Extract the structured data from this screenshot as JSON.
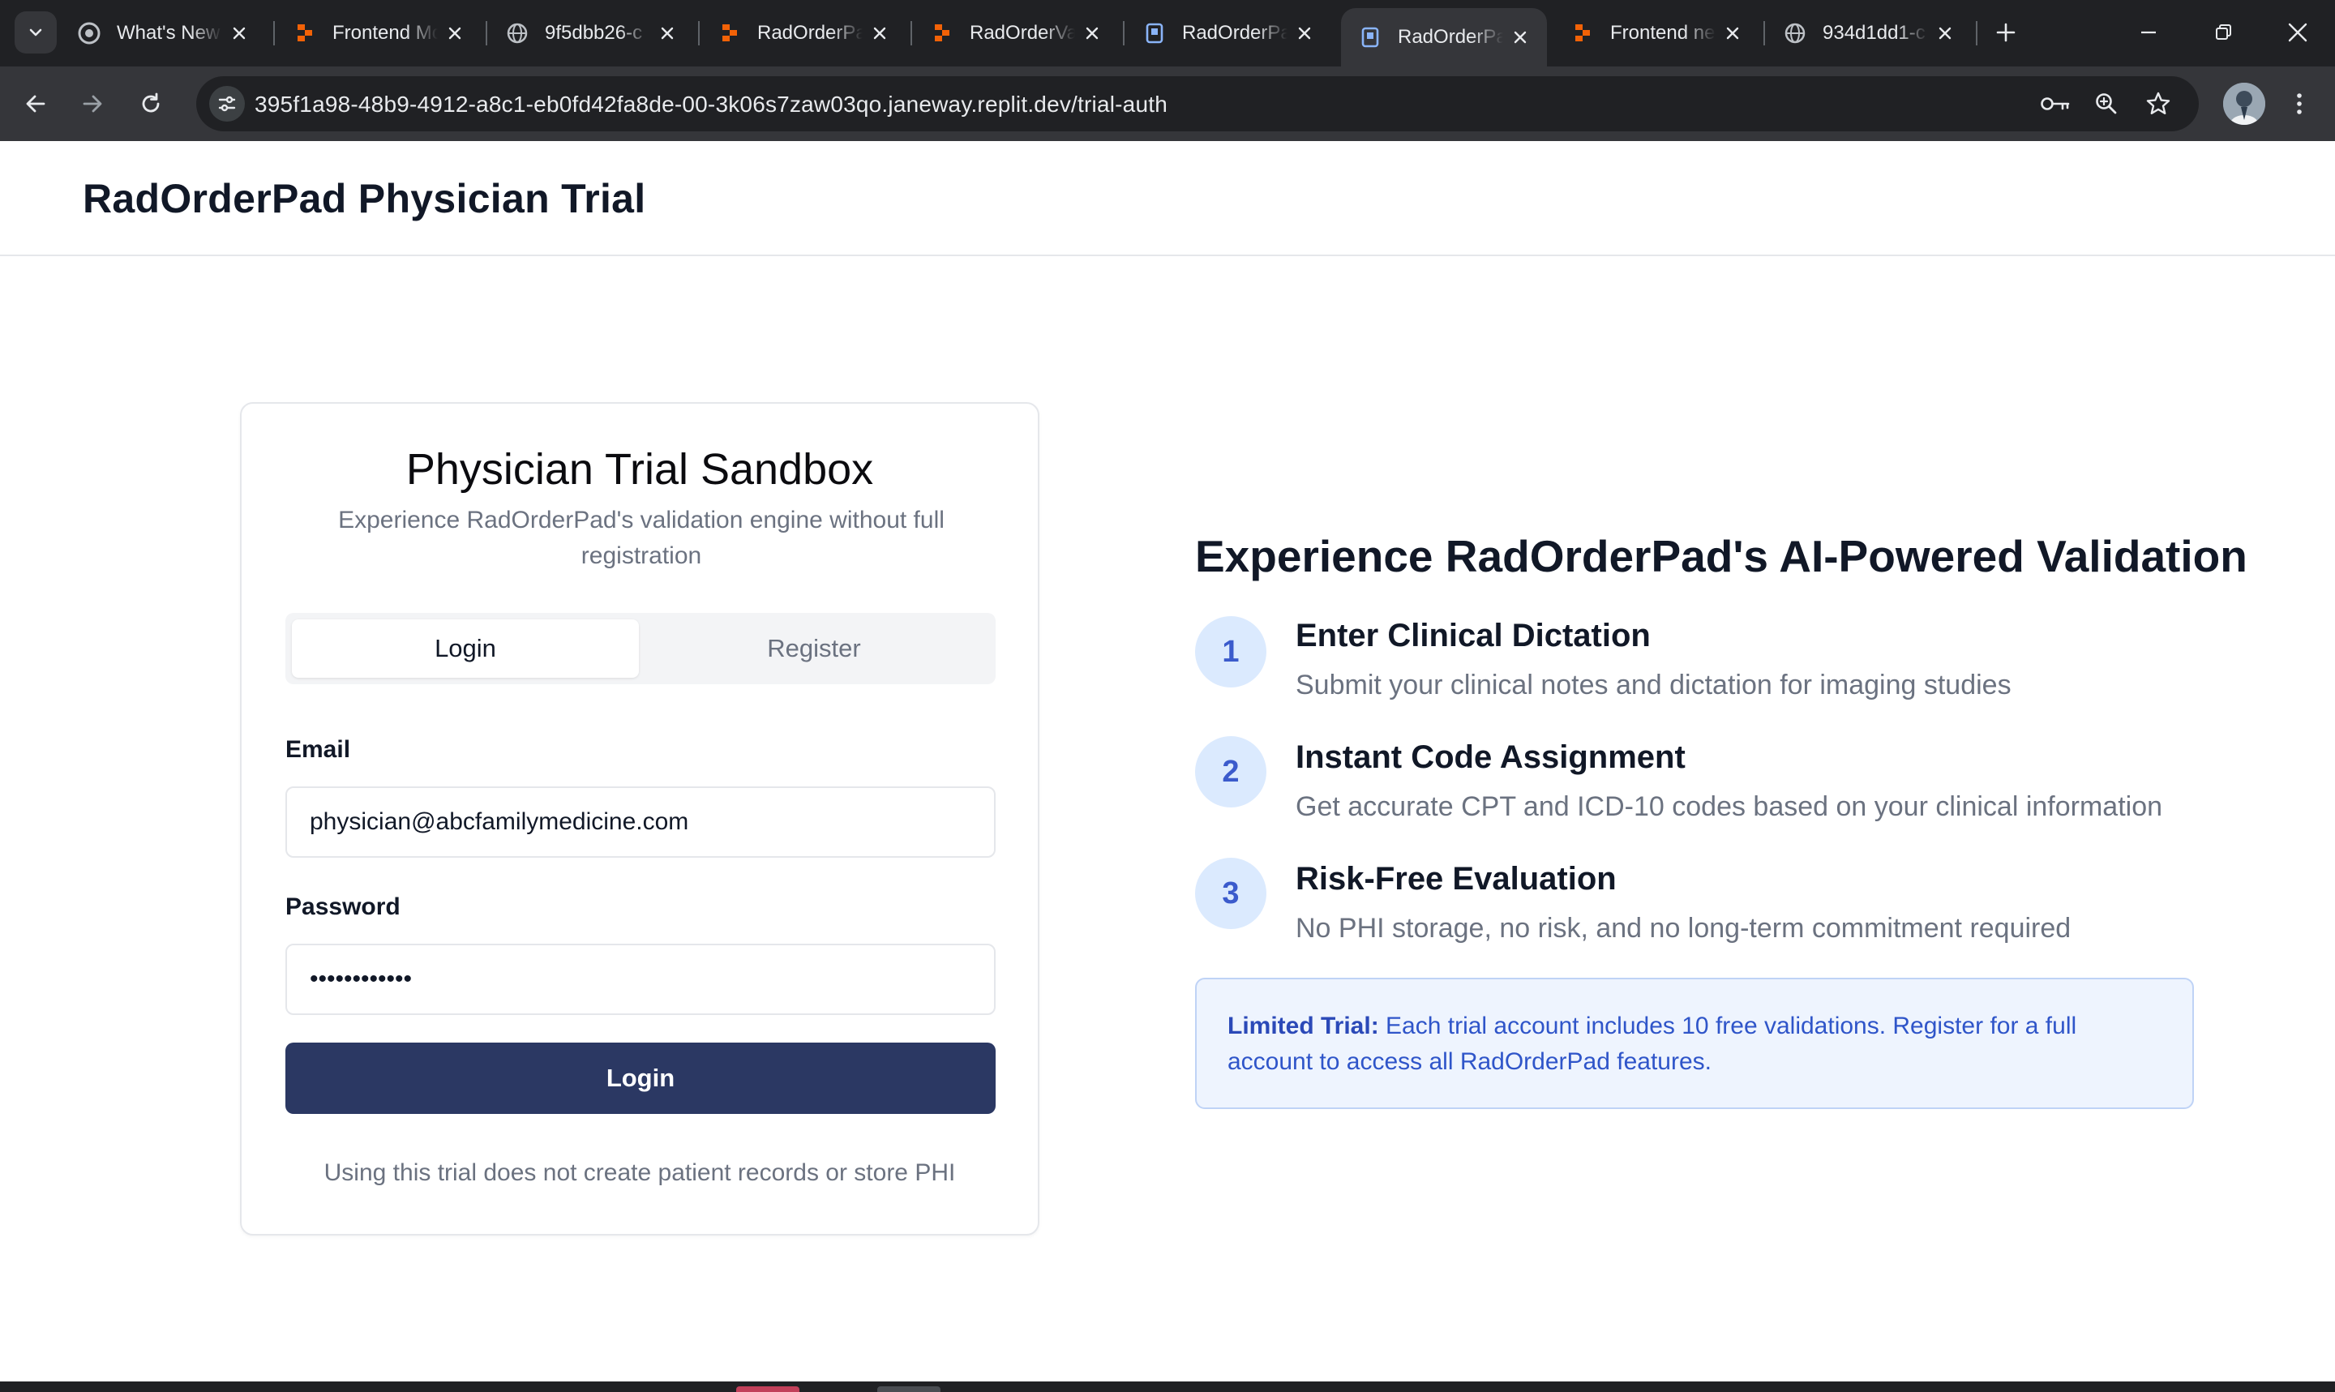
{
  "browser": {
    "tabs": [
      {
        "title": "What's New",
        "favicon": "chrome-icon",
        "active": false
      },
      {
        "title": "Frontend Modular",
        "favicon": "replit-icon",
        "active": false
      },
      {
        "title": "9f5dbb26-c",
        "favicon": "globe-icon",
        "active": false
      },
      {
        "title": "RadOrderPad",
        "favicon": "replit-icon",
        "active": false
      },
      {
        "title": "RadOrderValidation",
        "favicon": "replit-icon",
        "active": false
      },
      {
        "title": "RadOrderPad",
        "favicon": "document-icon",
        "active": false
      },
      {
        "title": "RadOrderPad",
        "favicon": "document-icon",
        "active": true
      },
      {
        "title": "Frontend new",
        "favicon": "replit-icon",
        "active": false
      },
      {
        "title": "934d1dd1-c",
        "favicon": "globe-icon",
        "active": false
      }
    ],
    "url": "395f1a98-48b9-4912-a8c1-eb0fd42fa8de-00-3k06s7zaw03qo.janeway.replit.dev/trial-auth"
  },
  "header": {
    "title": "RadOrderPad Physician Trial"
  },
  "login_card": {
    "title": "Physician Trial Sandbox",
    "subtitle": "Experience RadOrderPad's validation engine without full registration",
    "tabs": {
      "login": "Login",
      "register": "Register"
    },
    "email_label": "Email",
    "email_value": "physician@abcfamilymedicine.com",
    "password_label": "Password",
    "password_value": "••••••••••••",
    "submit_label": "Login",
    "footer": "Using this trial does not create patient records or store PHI"
  },
  "features": {
    "title": "Experience RadOrderPad's AI-Powered Validation",
    "steps": [
      {
        "number": "1",
        "title": "Enter Clinical Dictation",
        "description": "Submit your clinical notes and dictation for imaging studies"
      },
      {
        "number": "2",
        "title": "Instant Code Assignment",
        "description": "Get accurate CPT and ICD-10 codes based on your clinical information"
      },
      {
        "number": "3",
        "title": "Risk-Free Evaluation",
        "description": "No PHI storage, no risk, and no long-term commitment required"
      }
    ],
    "notice_label": "Limited Trial:",
    "notice_text": " Each trial account includes 10 free validations. Register for a full account to access all RadOrderPad features."
  },
  "colors": {
    "primary_button": "#2b3863",
    "accent_blue": "#3b5bcc",
    "notice_bg": "#eef4fe",
    "chrome_dark": "#202124",
    "chrome_toolbar": "#35363a"
  }
}
